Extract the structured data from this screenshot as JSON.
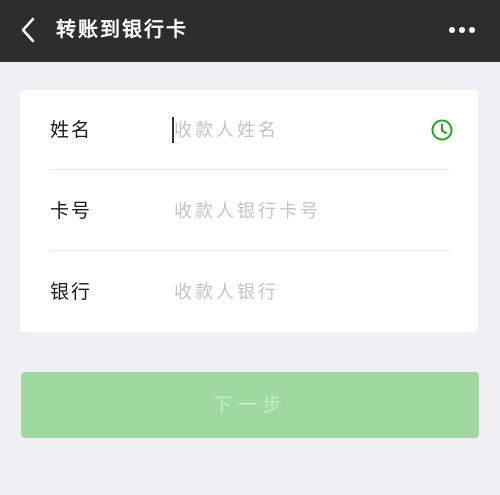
{
  "navbar": {
    "title": "转账到银行卡",
    "back_icon": "chevron-left-icon",
    "more_icon": "more-horizontal-icon"
  },
  "form": {
    "name": {
      "label": "姓名",
      "placeholder": "收款人姓名",
      "value": "",
      "history_icon": "clock-icon"
    },
    "card_number": {
      "label": "卡号",
      "placeholder": "收款人银行卡号",
      "value": ""
    },
    "bank": {
      "label": "银行",
      "placeholder": "收款人银行",
      "value": ""
    }
  },
  "next_button": {
    "label": "下一步",
    "enabled": false
  },
  "colors": {
    "navbar_bg": "#2d2d2d",
    "page_bg": "#efeff4",
    "accent_green": "#1aad19",
    "next_button_disabled_bg": "#9fd99f"
  }
}
